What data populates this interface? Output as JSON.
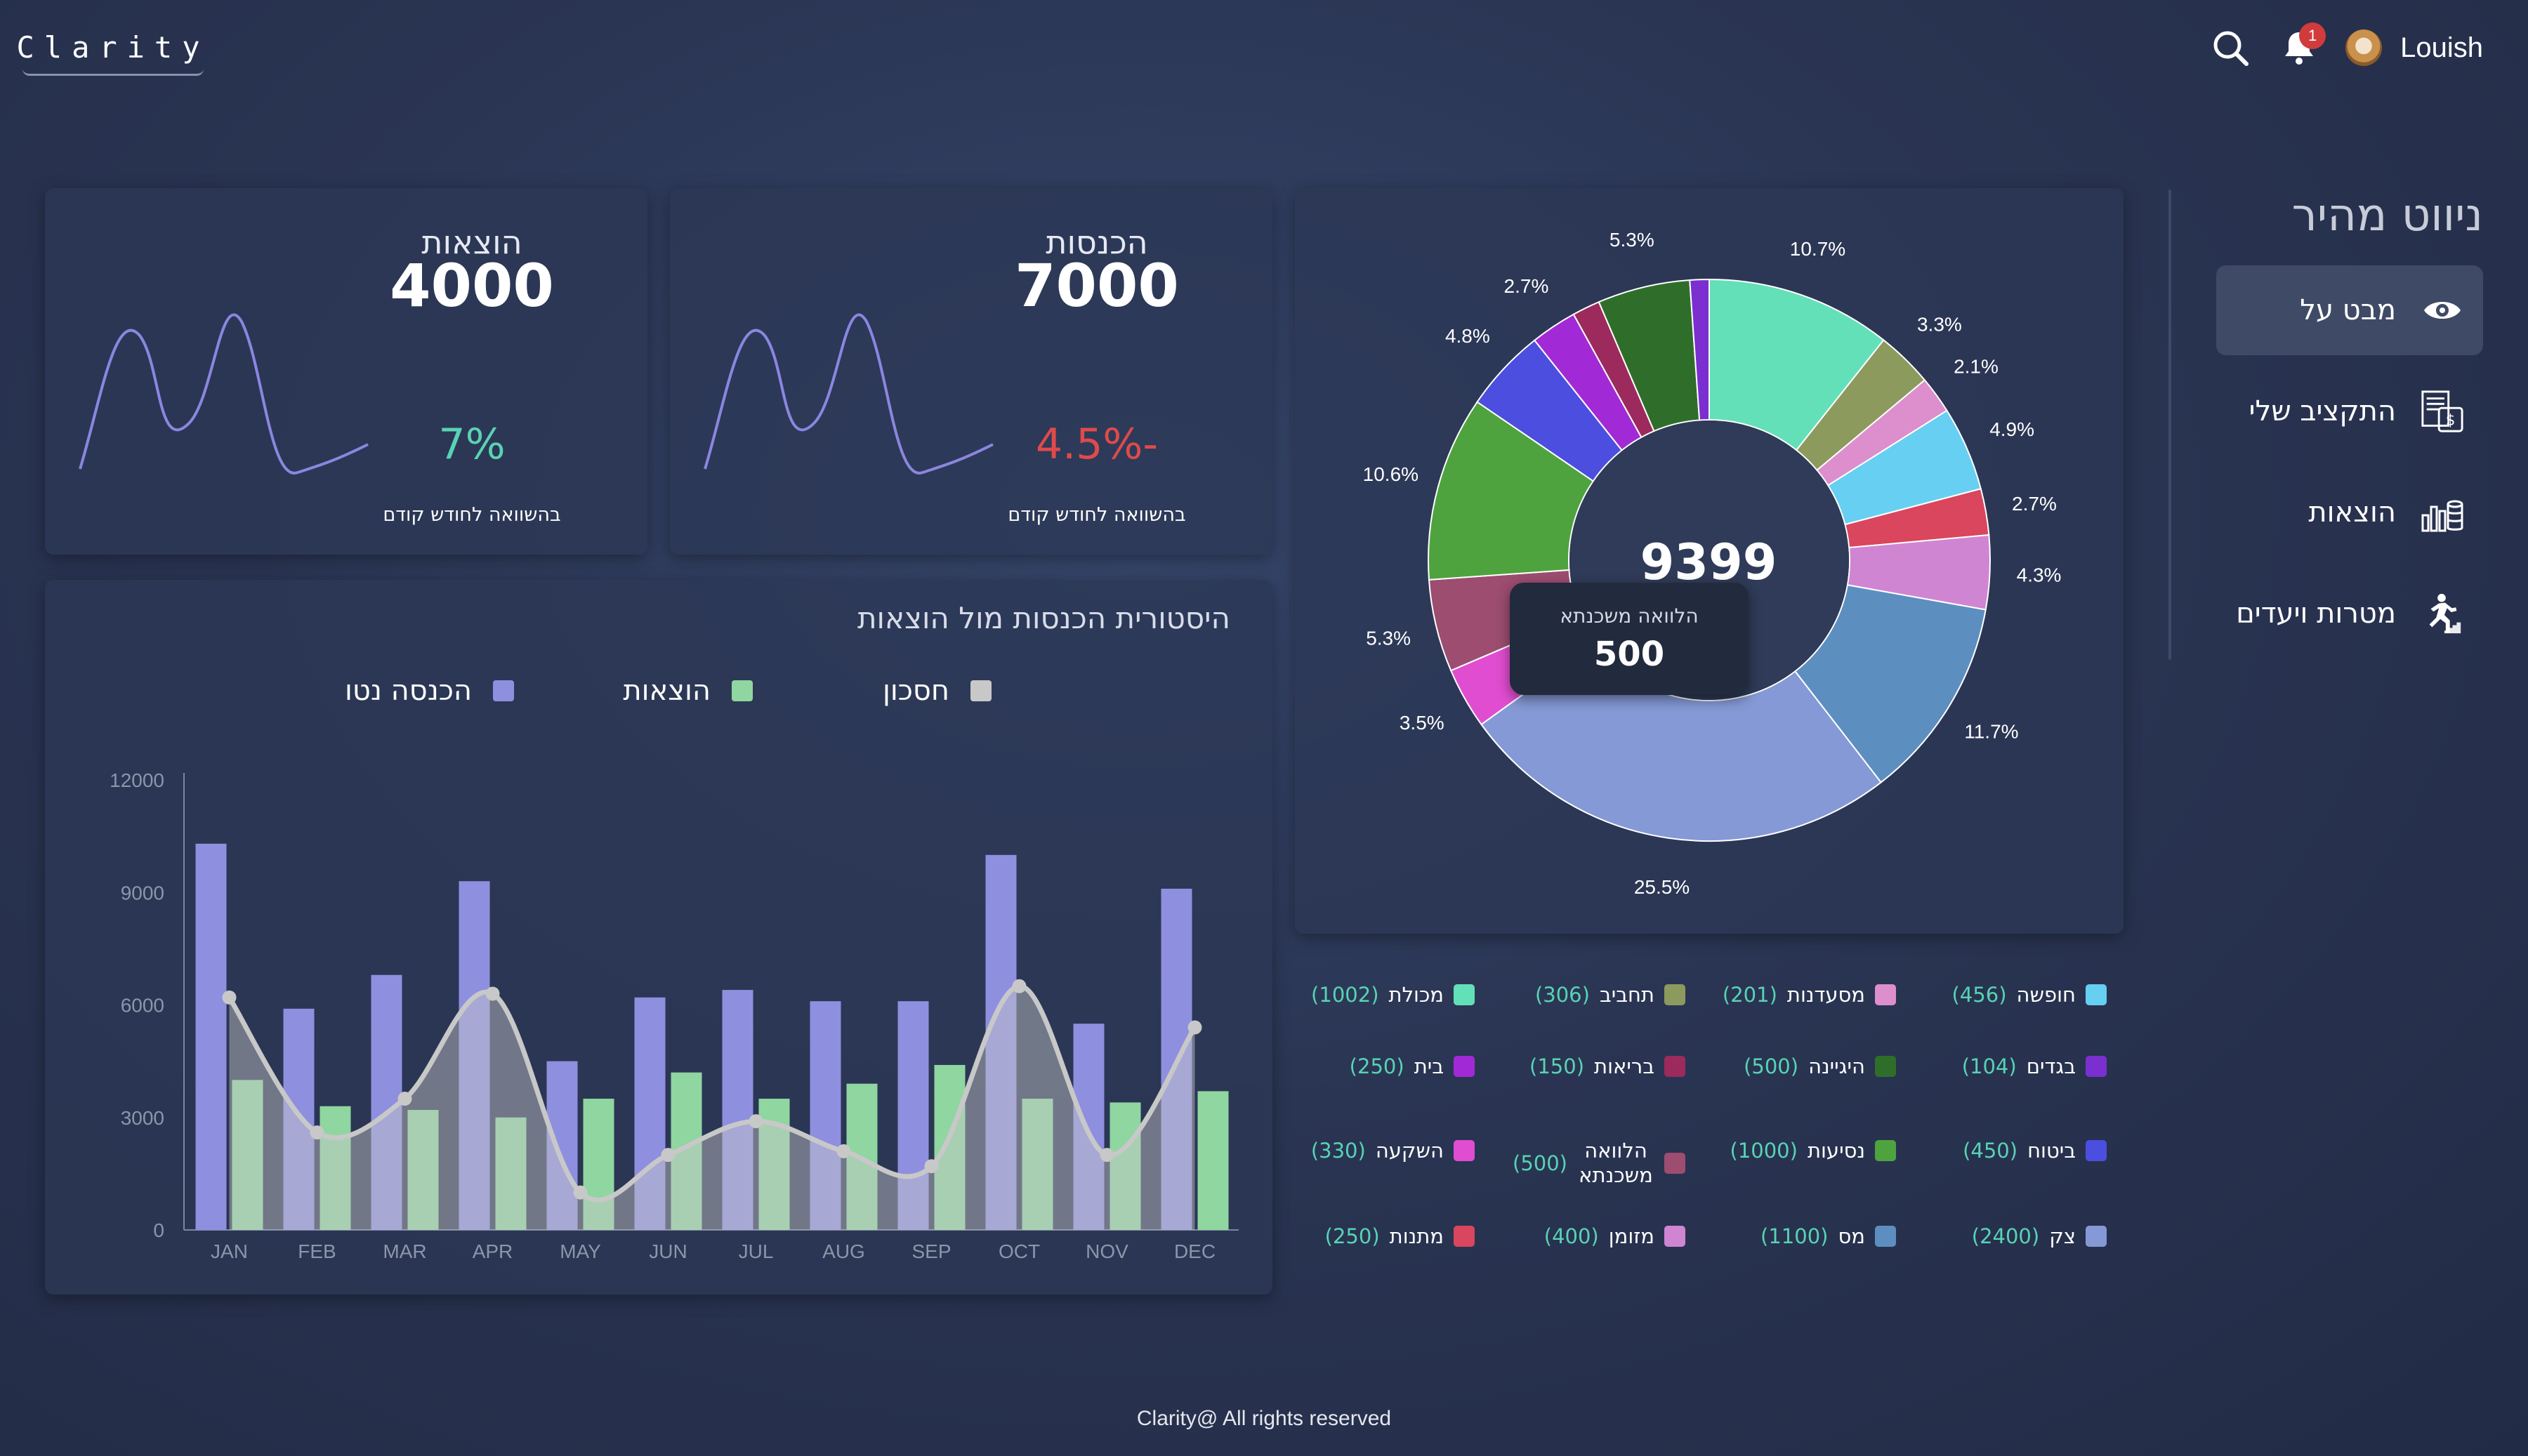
{
  "app": {
    "logo": "Clarity",
    "user_name": "Louish",
    "notification_count": "1"
  },
  "stats": [
    {
      "title": "הוצאות",
      "value": "4000",
      "change": "7%",
      "change_color": "#58d3b3",
      "note": "בהשוואה לחודש קודם"
    },
    {
      "title": "הכנסות",
      "value": "7000",
      "change": "4.5%-",
      "change_color": "#e04a4a",
      "note": "בהשוואה לחודש קודם"
    }
  ],
  "history": {
    "title": "היסטורית הכנסות מול הוצאות",
    "legend": [
      {
        "label": "הכנסה נטו",
        "color": "#8f8fe0"
      },
      {
        "label": "הוצאות",
        "color": "#8fd6a0"
      },
      {
        "label": "חסכון",
        "color": "#c8c8c8"
      }
    ]
  },
  "chart_data": [
    {
      "type": "bar",
      "title": "היסטורית הכנסות מול הוצאות",
      "categories": [
        "JAN",
        "FEB",
        "MAR",
        "APR",
        "MAY",
        "JUN",
        "JUL",
        "AUG",
        "SEP",
        "OCT",
        "NOV",
        "DEC"
      ],
      "series": [
        {
          "name": "הכנסה נטו",
          "type": "bar",
          "color": "#8f8fe0",
          "values": [
            10300,
            5900,
            6800,
            9300,
            4500,
            6200,
            6400,
            6100,
            6100,
            10000,
            5500,
            9100
          ]
        },
        {
          "name": "הוצאות",
          "type": "bar",
          "color": "#8fd6a0",
          "values": [
            4000,
            3300,
            3200,
            3000,
            3500,
            4200,
            3500,
            3900,
            4400,
            3500,
            3400,
            3700
          ]
        },
        {
          "name": "חסכון",
          "type": "area",
          "color": "#c8c8c8",
          "values": [
            6200,
            2600,
            3500,
            6300,
            1000,
            2000,
            2900,
            2100,
            1700,
            6500,
            2000,
            5400
          ]
        }
      ],
      "yticks": [
        0,
        3000,
        6000,
        9000,
        12000
      ],
      "ylim": [
        0,
        12000
      ],
      "grid": false,
      "legend_position": "top"
    },
    {
      "type": "pie",
      "total_label": "9399",
      "slices": [
        {
          "name": "מכולת",
          "value": 1002,
          "pct": "10.7%",
          "color": "#63e0b8"
        },
        {
          "name": "תחביב",
          "value": 306,
          "pct": "3.3%",
          "color": "#8c9a5e"
        },
        {
          "name": "מסעדנות",
          "value": 201,
          "pct": "2.1%",
          "color": "#dc8fcc"
        },
        {
          "name": "חופשה",
          "value": 456,
          "pct": "4.9%",
          "color": "#67cff2"
        },
        {
          "name": "מתנות",
          "value": 250,
          "pct": "2.7%",
          "color": "#d9465d"
        },
        {
          "name": "מזומן",
          "value": 400,
          "pct": "4.3%",
          "color": "#d085d2"
        },
        {
          "name": "מס",
          "value": 1100,
          "pct": "11.7%",
          "color": "#5d8ec0"
        },
        {
          "name": "צק",
          "value": 2400,
          "pct": "25.5%",
          "color": "#8599d6"
        },
        {
          "name": "השקעה",
          "value": 330,
          "pct": "3.5%",
          "color": "#e04dd0"
        },
        {
          "name": "הלוואה משכנתא",
          "value": 500,
          "pct": "5.3%",
          "color": "#9c4d70"
        },
        {
          "name": "נסיעות",
          "value": 1000,
          "pct": "10.6%",
          "color": "#4ea33e"
        },
        {
          "name": "ביטוח",
          "value": 450,
          "pct": "4.8%",
          "color": "#4b4ede"
        },
        {
          "name": "בית",
          "value": 250,
          "pct": "2.7%",
          "color": "#a22ad6"
        },
        {
          "name": "בריאות",
          "value": 150,
          "pct": "",
          "color": "#9c2a5c"
        },
        {
          "name": "היגיינה",
          "value": 500,
          "pct": "5.3%",
          "color": "#2f6e2a"
        },
        {
          "name": "בגדים",
          "value": 104,
          "pct": "",
          "color": "#7b2fd0"
        }
      ],
      "tooltip": {
        "label": "הלוואה משכנתא",
        "value": "500"
      }
    }
  ],
  "categories_grid": [
    [
      {
        "name": "חופשה",
        "amount": "(456)",
        "color": "#67cff2"
      },
      {
        "name": "מסעדנות",
        "amount": "(201)",
        "color": "#dc8fcc"
      },
      {
        "name": "תחביב",
        "amount": "(306)",
        "color": "#8c9a5e"
      },
      {
        "name": "מכולת",
        "amount": "(1002)",
        "color": "#63e0b8"
      }
    ],
    [
      {
        "name": "בגדים",
        "amount": "(104)",
        "color": "#7b2fd0"
      },
      {
        "name": "היגיינה",
        "amount": "(500)",
        "color": "#2f6e2a"
      },
      {
        "name": "בריאות",
        "amount": "(150)",
        "color": "#9c2a5c"
      },
      {
        "name": "בית",
        "amount": "(250)",
        "color": "#a22ad6"
      }
    ],
    [
      {
        "name": "ביטוח",
        "amount": "(450)",
        "color": "#4b4ede"
      },
      {
        "name": "נסיעות",
        "amount": "(1000)",
        "color": "#4ea33e"
      },
      {
        "name": "הלוואה משכנתא",
        "amount": "(500)",
        "color": "#9c4d70"
      },
      {
        "name": "השקעה",
        "amount": "(330)",
        "color": "#e04dd0"
      }
    ],
    [
      {
        "name": "צק",
        "amount": "(2400)",
        "color": "#8599d6"
      },
      {
        "name": "מס",
        "amount": "(1100)",
        "color": "#5d8ec0"
      },
      {
        "name": "מזומן",
        "amount": "(400)",
        "color": "#d085d2"
      },
      {
        "name": "מתנות",
        "amount": "(250)",
        "color": "#d9465d"
      }
    ]
  ],
  "nav": {
    "title": "ניווט מהיר",
    "items": [
      {
        "label": "מבט על",
        "icon": "eye-icon",
        "active": true
      },
      {
        "label": "התקציב שלי",
        "icon": "budget-icon",
        "active": false
      },
      {
        "label": "הוצאות",
        "icon": "expenses-icon",
        "active": false
      },
      {
        "label": "מטרות ויעדים",
        "icon": "goals-icon",
        "active": false
      }
    ]
  },
  "footer": {
    "text": "Clarity@ All rights reserved"
  }
}
